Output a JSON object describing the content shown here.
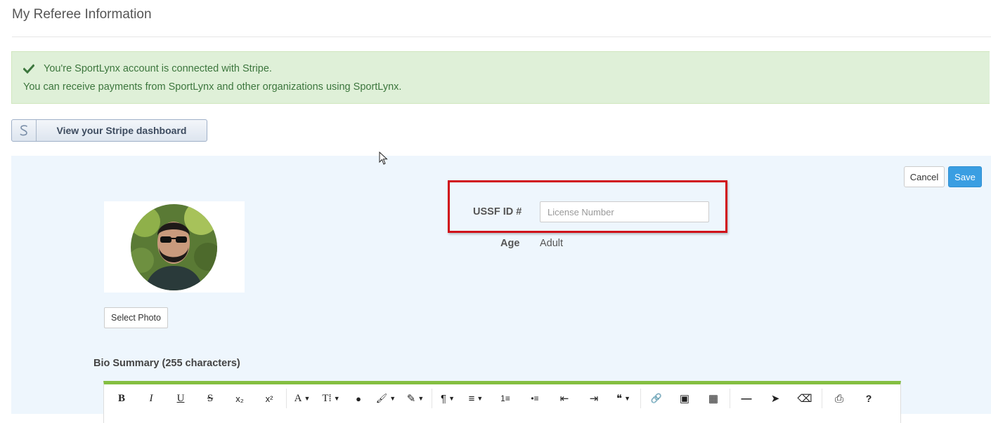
{
  "page": {
    "title": "My Referee Information"
  },
  "alert": {
    "line1": "You're SportLynx account is connected with Stripe.",
    "line2": "You can receive payments from SportLynx and other organizations using SportLynx.",
    "icon": "checkmark-icon",
    "color": "#3c763d"
  },
  "stripe": {
    "button_label": "View your Stripe dashboard",
    "icon": "stripe-s-icon"
  },
  "actions": {
    "cancel_label": "Cancel",
    "save_label": "Save",
    "save_color": "#3a9ee2"
  },
  "profile": {
    "select_photo_label": "Select Photo"
  },
  "form": {
    "ussf_label": "USSF ID #",
    "ussf_value": "",
    "ussf_placeholder": "License Number",
    "age_label": "Age",
    "age_value": "Adult"
  },
  "bio": {
    "label": "Bio Summary (255 characters)"
  },
  "editor": {
    "accent": "#84bf41",
    "toolbar": [
      {
        "name": "bold",
        "glyph": "B"
      },
      {
        "name": "italic",
        "glyph": "I"
      },
      {
        "name": "underline",
        "glyph": "U"
      },
      {
        "name": "strikethrough",
        "glyph": "S"
      },
      {
        "name": "subscript",
        "glyph": "x₂"
      },
      {
        "name": "superscript",
        "glyph": "x²"
      },
      {
        "name": "font-family",
        "glyph": "A"
      },
      {
        "name": "font-size",
        "glyph": "T⁞"
      },
      {
        "name": "color",
        "glyph": "●"
      },
      {
        "name": "paint",
        "glyph": "🖌"
      },
      {
        "name": "style",
        "glyph": "✎"
      },
      {
        "name": "paragraph",
        "glyph": "¶"
      },
      {
        "name": "align",
        "glyph": "≡"
      },
      {
        "name": "ordered-list",
        "glyph": "1≡"
      },
      {
        "name": "unordered-list",
        "glyph": "•≡"
      },
      {
        "name": "outdent",
        "glyph": "⇤"
      },
      {
        "name": "indent",
        "glyph": "⇥"
      },
      {
        "name": "quote",
        "glyph": "❝"
      },
      {
        "name": "link",
        "glyph": "🔗"
      },
      {
        "name": "image",
        "glyph": "▣"
      },
      {
        "name": "table",
        "glyph": "▦"
      },
      {
        "name": "horizontal-rule",
        "glyph": "—"
      },
      {
        "name": "select",
        "glyph": "➤"
      },
      {
        "name": "clear-formatting",
        "glyph": "⌫"
      },
      {
        "name": "print",
        "glyph": "⎙"
      },
      {
        "name": "help",
        "glyph": "?"
      }
    ]
  }
}
